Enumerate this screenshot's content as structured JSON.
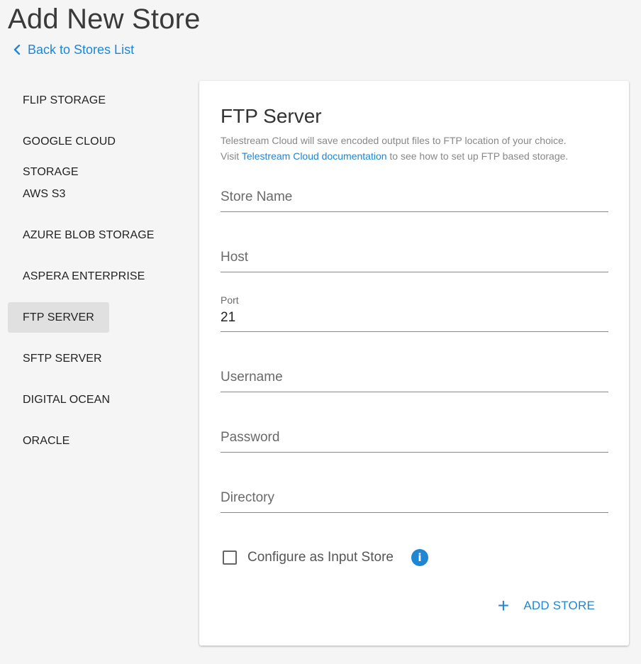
{
  "page": {
    "title": "Add New Store",
    "back_label": "Back to Stores List"
  },
  "sidebar": {
    "items": [
      {
        "label": "FLIP STORAGE",
        "active": false
      },
      {
        "label": "GOOGLE CLOUD STORAGE",
        "active": false
      },
      {
        "label": "AWS S3",
        "active": false
      },
      {
        "label": "AZURE BLOB STORAGE",
        "active": false
      },
      {
        "label": "ASPERA ENTERPRISE",
        "active": false
      },
      {
        "label": "FTP SERVER",
        "active": true
      },
      {
        "label": "SFTP SERVER",
        "active": false
      },
      {
        "label": "DIGITAL OCEAN",
        "active": false
      },
      {
        "label": "ORACLE",
        "active": false
      }
    ]
  },
  "form": {
    "title": "FTP Server",
    "desc_line1": "Telestream Cloud will save encoded output files to FTP location of your choice.",
    "desc_visit": "Visit ",
    "desc_link": "Telestream Cloud documentation",
    "desc_after": " to see how to set up FTP based storage.",
    "store_name_placeholder": "Store Name",
    "host_placeholder": "Host",
    "port_label": "Port",
    "port_value": "21",
    "username_placeholder": "Username",
    "password_placeholder": "Password",
    "directory_placeholder": "Directory",
    "input_store_label": "Configure as Input Store",
    "input_store_checked": false,
    "add_store_label": "ADD STORE"
  },
  "colors": {
    "accent": "#1f86d4",
    "background": "#f5f5f5",
    "active_item": "#e0e0e0"
  },
  "icons": [
    "chevron-left-icon",
    "info-icon",
    "plus-icon"
  ]
}
